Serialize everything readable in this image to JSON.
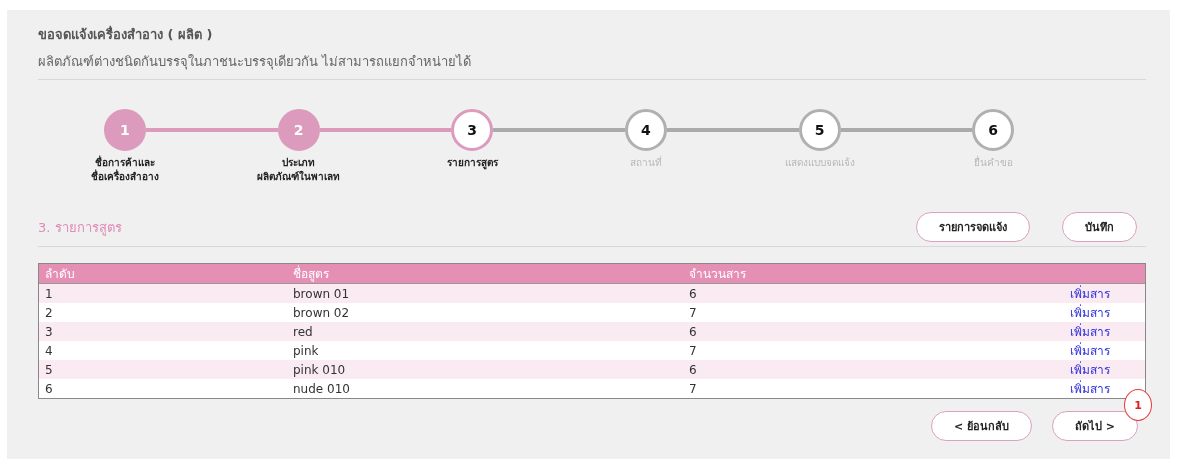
{
  "header": {
    "title": "ขอจดแจ้งเครื่องสำอาง ( ผลิต )",
    "subtitle": "ผลิตภัณฑ์ต่างชนิดกันบรรจุในภาชนะบรรจุเดียวกัน ไม่สามารถแยกจำหน่ายได้"
  },
  "steps": [
    {
      "number": "1",
      "label": "ชื่อการค้าและ\nชื่อเครื่องสำอาง",
      "completed": true,
      "selected": false
    },
    {
      "number": "2",
      "label": "ประเภท\nผลิตภัณฑ์ในพาเลท",
      "completed": true,
      "selected": false
    },
    {
      "number": "3",
      "label": "รายการสูตร",
      "completed": false,
      "selected": true
    },
    {
      "number": "4",
      "label": "สถานที่",
      "completed": false,
      "selected": false
    },
    {
      "number": "5",
      "label": "แสดงแบบจดแจ้ง",
      "completed": false,
      "selected": false
    },
    {
      "number": "6",
      "label": "ยื่นคำขอ",
      "completed": false,
      "selected": false
    }
  ],
  "section": {
    "title": "3. รายการสูตร",
    "buttons": [
      "รายการจดแจ้ง",
      "บันทึก"
    ]
  },
  "table": {
    "columns": [
      "ลำดับ",
      "ชื่อสูตร",
      "จำนวนสาร"
    ],
    "rows": [
      {
        "cells": [
          "1",
          "brown 01",
          "6"
        ],
        "action": "เพิ่มสาร"
      },
      {
        "cells": [
          "2",
          "brown 02",
          "7"
        ],
        "action": "เพิ่มสาร"
      },
      {
        "cells": [
          "3",
          "red",
          "6"
        ],
        "action": "เพิ่มสาร"
      },
      {
        "cells": [
          "4",
          "pink",
          "7"
        ],
        "action": "เพิ่มสาร"
      },
      {
        "cells": [
          "5",
          "pink 010",
          "6"
        ],
        "action": "เพิ่มสาร"
      },
      {
        "cells": [
          "6",
          "nude 010",
          "7"
        ],
        "action": "เพิ่มสาร"
      }
    ]
  },
  "footer": {
    "back": "< ย้อนกลับ",
    "next": "ถัดไป >",
    "callout": "1"
  }
}
